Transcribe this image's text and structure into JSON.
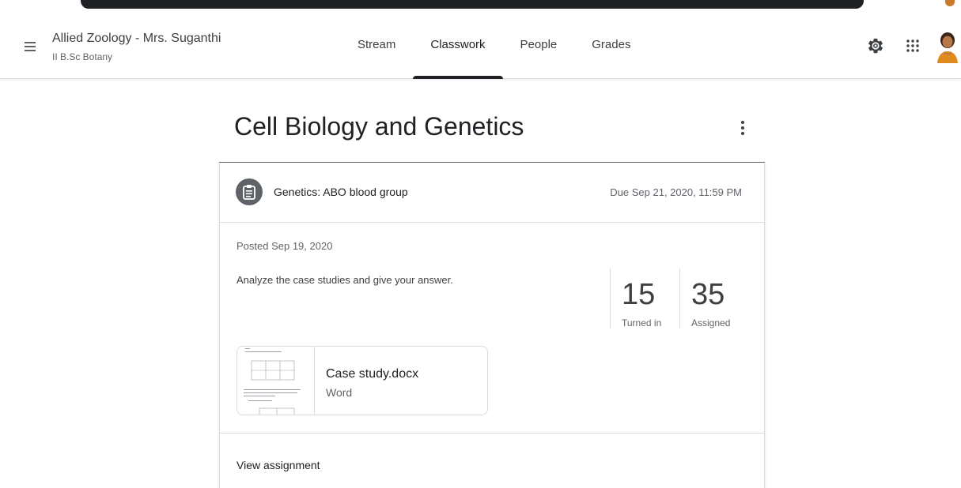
{
  "header": {
    "class_title": "Allied Zoology - Mrs. Suganthi",
    "class_subtitle": "II B.Sc Botany",
    "tabs": [
      {
        "label": "Stream"
      },
      {
        "label": "Classwork",
        "active": true
      },
      {
        "label": "People"
      },
      {
        "label": "Grades"
      }
    ],
    "icons": [
      "menu-icon",
      "gear-icon",
      "apps-grid-icon",
      "user-avatar"
    ]
  },
  "topic": {
    "title": "Cell Biology and Genetics"
  },
  "assignment": {
    "title": "Genetics: ABO blood group",
    "due": "Due Sep 21, 2020, 11:59 PM",
    "posted": "Posted Sep 19, 2020",
    "instructions": "Analyze the case studies and give your answer.",
    "turned_in_count": "15",
    "turned_in_label": "Turned in",
    "assigned_count": "35",
    "assigned_label": "Assigned",
    "attachment": {
      "name": "Case study.docx",
      "type": "Word"
    },
    "view_label": "View assignment"
  },
  "colors": {
    "text_primary": "#202124",
    "text_secondary": "#5f6368",
    "divider": "#dadce0",
    "icon_bg": "#5f6368"
  }
}
